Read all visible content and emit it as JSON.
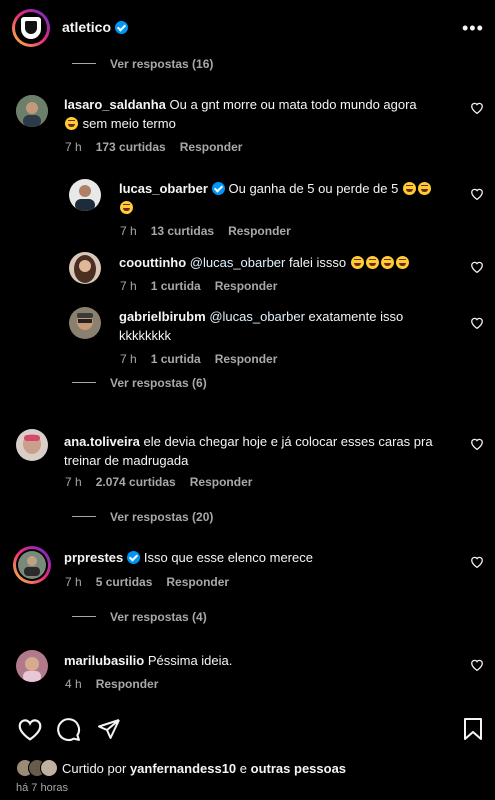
{
  "header": {
    "username": "atletico",
    "verified": true,
    "more_icon": "more-horizontal-icon"
  },
  "view_replies": [
    "Ver respostas (16)",
    "Ver respostas (6)",
    "Ver respostas (20)",
    "Ver respostas (4)"
  ],
  "comments": [
    {
      "user": "lasaro_saldanha",
      "text1": "Ou a gnt morre ou mata todo mundo agora",
      "text2": "sem meio termo",
      "time": "7 h",
      "likes": "173 curtidas",
      "reply": "Responder"
    },
    {
      "user": "lucas_obarber",
      "text1": "Ou ganha de 5 ou perde de 5",
      "time": "7 h",
      "likes": "13 curtidas",
      "reply": "Responder"
    },
    {
      "user": "coouttinho",
      "mention": "@lucas_obarber",
      "text1": "falei issso",
      "time": "7 h",
      "likes": "1 curtida",
      "reply": "Responder"
    },
    {
      "user": "gabrielbirubm",
      "mention": "@lucas_obarber",
      "text1": "exatamente isso",
      "text2": "kkkkkkkk",
      "time": "7 h",
      "likes": "1 curtida",
      "reply": "Responder"
    },
    {
      "user": "ana.toliveira",
      "text1": "ele devia chegar hoje e já colocar esses caras pra",
      "text2": "treinar de madrugada",
      "time": "7 h",
      "likes": "2.074 curtidas",
      "reply": "Responder"
    },
    {
      "user": "prprestes",
      "text1": "Isso que esse elenco merece",
      "time": "7 h",
      "likes": "5 curtidas",
      "reply": "Responder"
    },
    {
      "user": "marilubasilio",
      "text1": "Péssima ideia.",
      "time": "4 h",
      "reply": "Responder"
    }
  ],
  "footer": {
    "liked_prefix": "Curtido por",
    "liked_user": "yanfernandess10",
    "liked_mid": "e",
    "liked_others": "outras pessoas",
    "time_ago": "há 7 horas"
  },
  "colors": {
    "background": "#000000",
    "text": "#f5f5f5",
    "secondary": "#a8a8a8",
    "verified": "#0095f6"
  }
}
